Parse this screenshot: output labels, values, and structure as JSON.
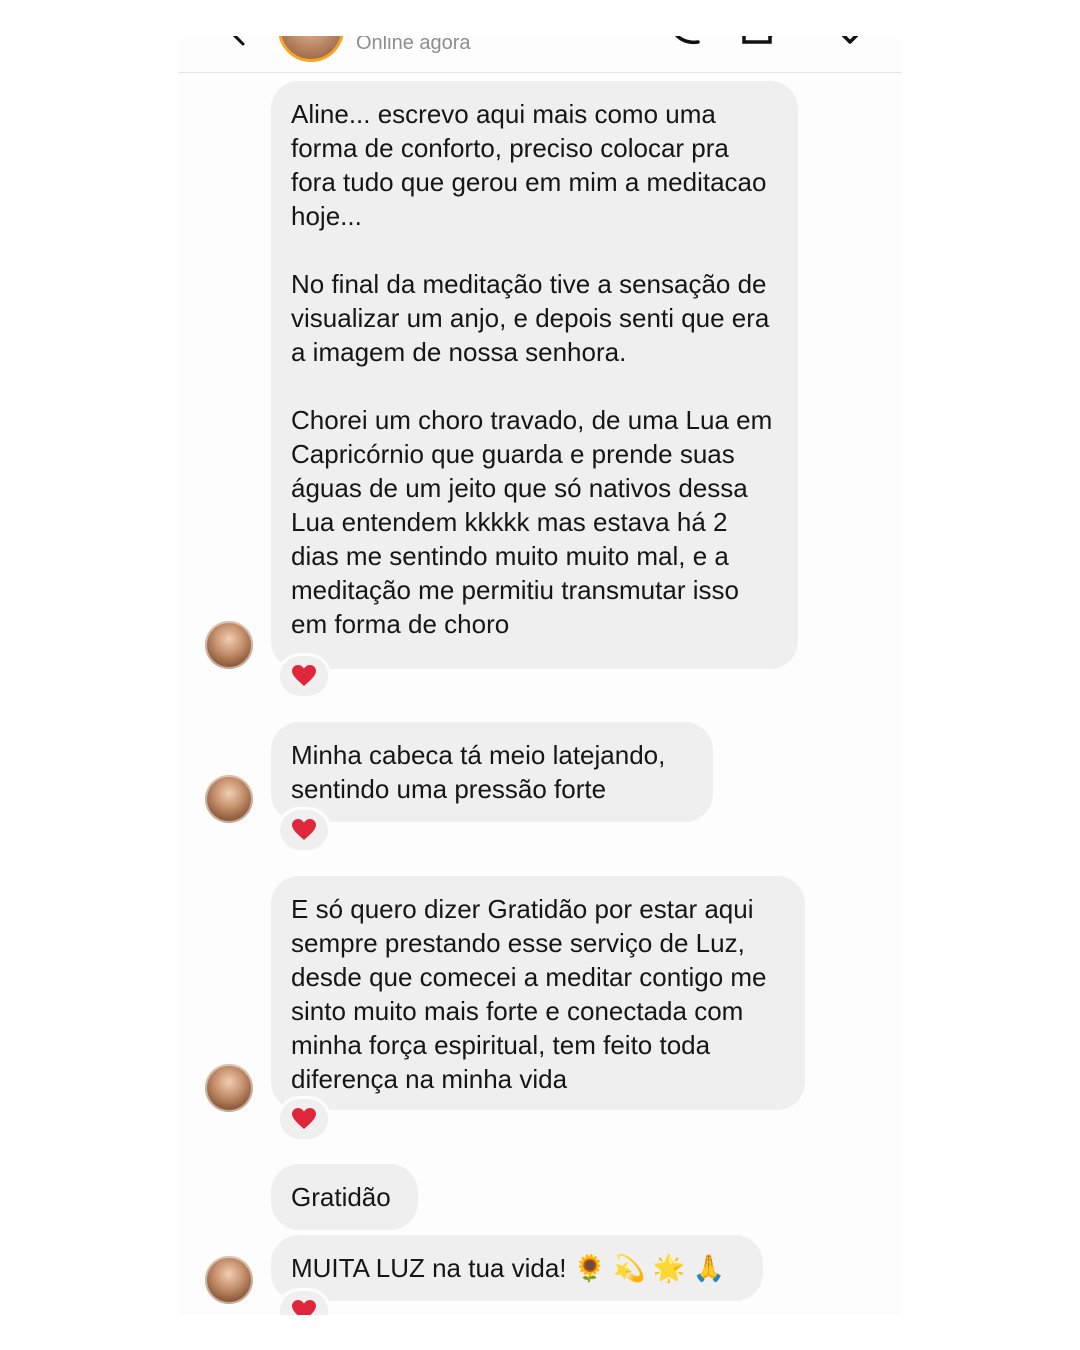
{
  "header": {
    "status": "Online agora",
    "icons": [
      "back-icon",
      "avatar",
      "call-icon",
      "video-icon",
      "info-icon"
    ]
  },
  "messages": [
    {
      "text": "Aline... escrevo aqui mais como uma forma de conforto, preciso colocar pra fora tudo que gerou em mim a meditacao hoje...\n\nNo final da meditação tive a sensação de visualizar um anjo, e depois senti que era a imagem de nossa senhora.\n\nChorei um choro travado, de uma Lua em Capricórnio que guarda e prende suas águas de um jeito que só nativos dessa Lua entendem kkkkk mas estava há 2 dias me sentindo muito muito mal, e a meditação me permitiu transmutar isso em forma de choro",
      "reaction": "heart"
    },
    {
      "text": "Minha cabeca tá meio latejando, sentindo uma pressão forte",
      "reaction": "heart"
    },
    {
      "text": "E só quero dizer Gratidão por estar aqui sempre prestando esse serviço de Luz, desde que comecei a meditar contigo me sinto muito mais forte e conectada com minha força espiritual, tem feito toda diferença na minha vida",
      "reaction": "heart"
    },
    {
      "text": "Gratidão",
      "reaction": null
    },
    {
      "text": "MUITA LUZ na tua vida! 🌻 💫 🌟 🙏",
      "reaction": "heart"
    }
  ],
  "colors": {
    "bubble": "#efefef",
    "heart": "#e0263a",
    "ring": "#f5a623",
    "status": "#8e8e8e"
  }
}
